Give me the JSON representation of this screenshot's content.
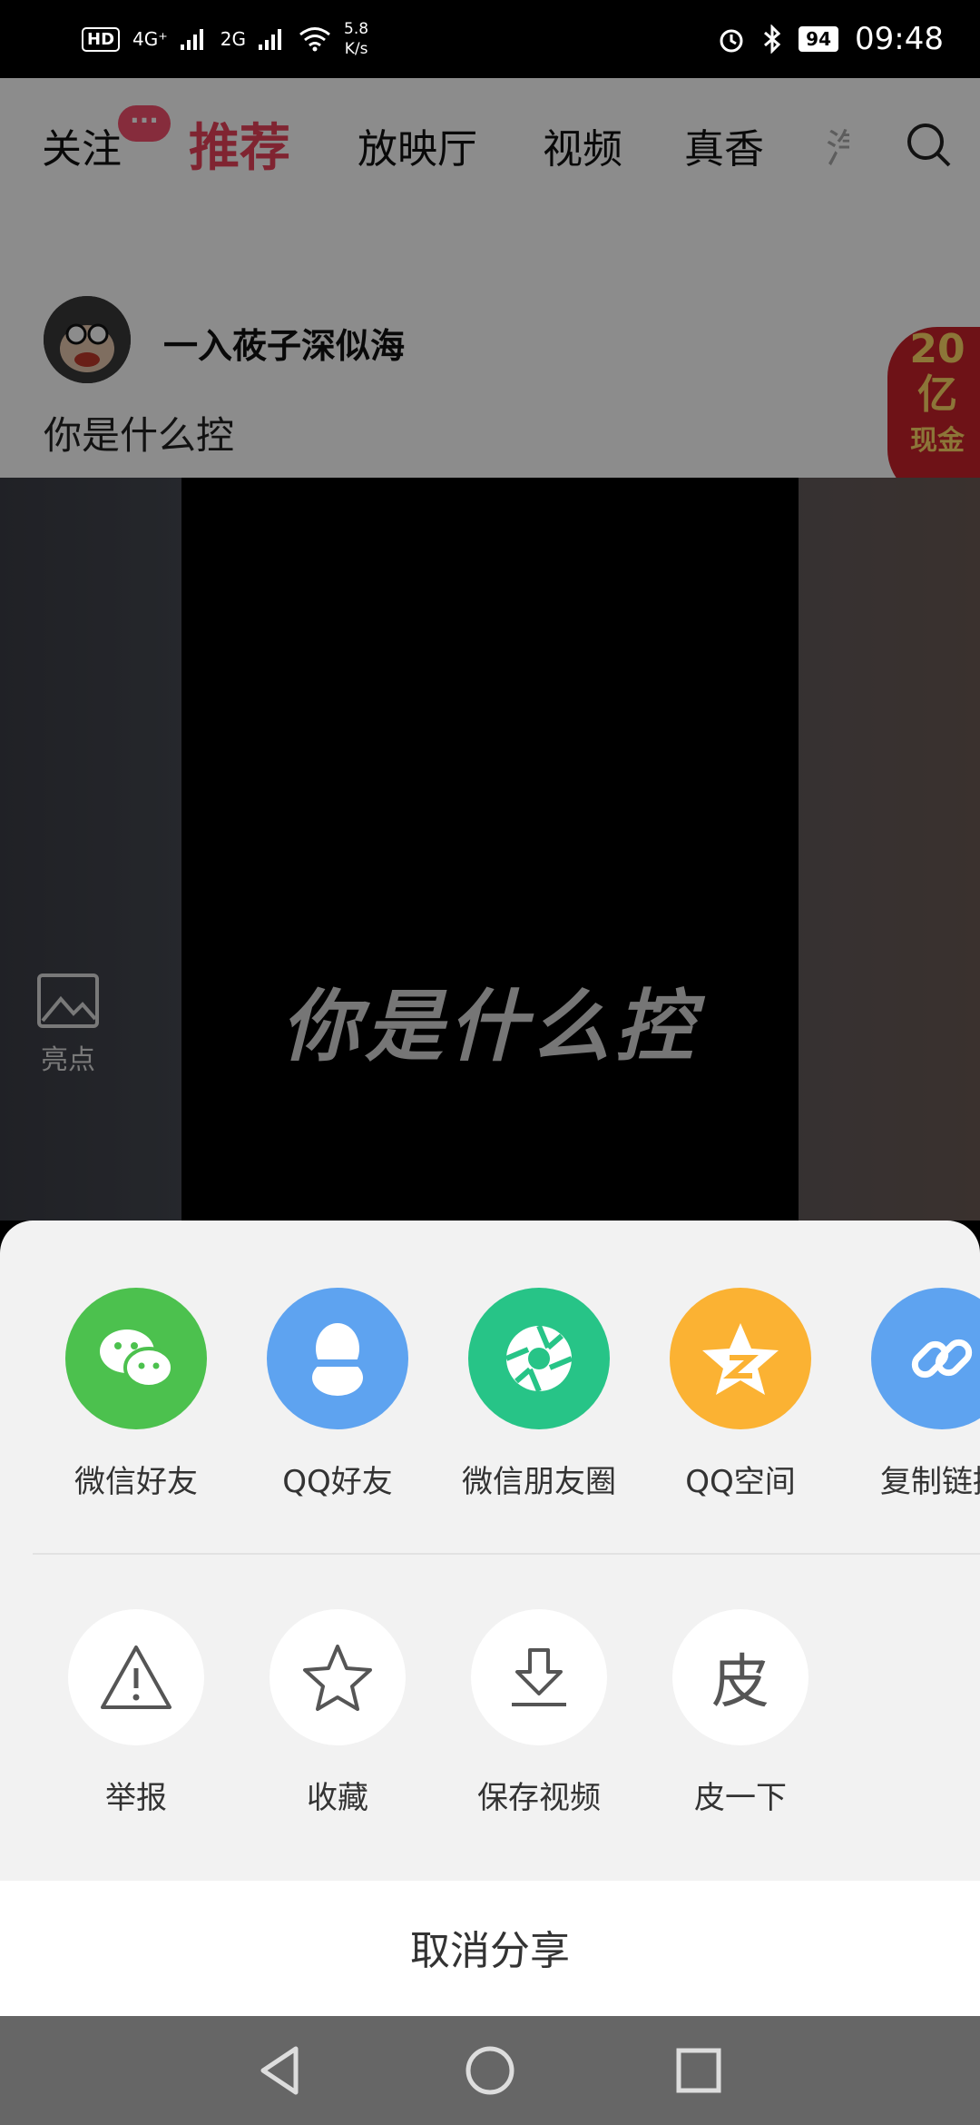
{
  "status_bar": {
    "hd": "HD",
    "signal1": "4G⁺",
    "signal2": "2G",
    "net_speed_value": "5.8",
    "net_speed_unit": "K/s",
    "battery": "94",
    "time": "09:48"
  },
  "top_tabs": {
    "items": [
      "关注",
      "推荐",
      "放映厅",
      "视频",
      "真香",
      "汽"
    ],
    "active": "推荐",
    "badge": "···"
  },
  "post": {
    "username": "一入莜子深似海",
    "caption": "你是什么控",
    "video_overlay_text": "你是什么控",
    "side_label": "亮点",
    "promo": {
      "line1": "20",
      "line2": "亿",
      "line3": "现金"
    }
  },
  "share_sheet": {
    "targets": [
      {
        "label": "微信好友",
        "color": "#4cc14e"
      },
      {
        "label": "QQ好友",
        "color": "#5ea3f0"
      },
      {
        "label": "微信朋友圈",
        "color": "#27c487"
      },
      {
        "label": "QQ空间",
        "color": "#fbb233"
      },
      {
        "label": "复制链接",
        "color": "#5ea3f0"
      }
    ],
    "actions": [
      {
        "label": "举报",
        "icon": "warning-icon"
      },
      {
        "label": "收藏",
        "icon": "star-icon"
      },
      {
        "label": "保存视频",
        "icon": "download-icon"
      },
      {
        "label": "皮一下",
        "icon": "pi-icon",
        "glyph": "皮"
      }
    ],
    "cancel": "取消分享"
  },
  "colors": {
    "accent": "#e9435a"
  }
}
